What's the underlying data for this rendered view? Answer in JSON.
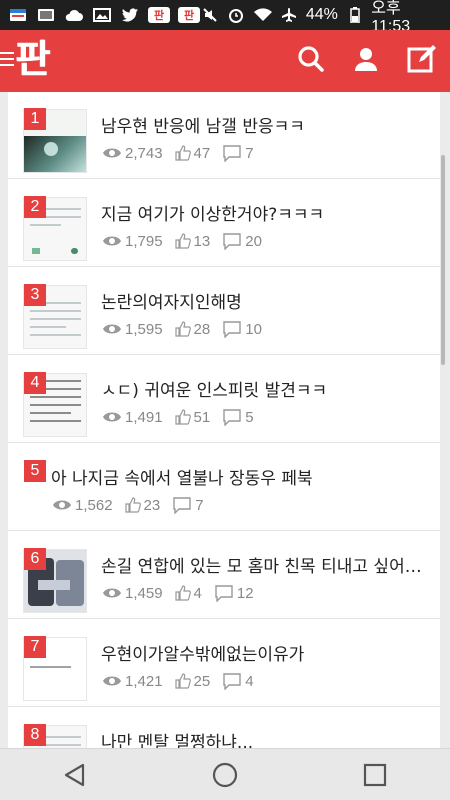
{
  "status_bar": {
    "battery": "44%",
    "time": "오후 11:53",
    "app_badge_1": "판",
    "app_badge_2": "판"
  },
  "header": {
    "logo": "판"
  },
  "items": [
    {
      "rank": "1",
      "title": "남우현 반응에 남갤 반응ㅋㅋ",
      "views": "2,743",
      "likes": "47",
      "comments": "7"
    },
    {
      "rank": "2",
      "title": "지금 여기가 이상한거야?ㅋㅋㅋ",
      "views": "1,795",
      "likes": "13",
      "comments": "20"
    },
    {
      "rank": "3",
      "title": "논란의여자지인해명",
      "views": "1,595",
      "likes": "28",
      "comments": "10"
    },
    {
      "rank": "4",
      "title": "ㅅㄷ) 귀여운 인스피릿 발견ㅋㅋ",
      "views": "1,491",
      "likes": "51",
      "comments": "5"
    },
    {
      "rank": "5",
      "title": "아 나지금 속에서 열불나 장동우 페북",
      "views": "1,562",
      "likes": "23",
      "comments": "7"
    },
    {
      "rank": "6",
      "title": "손길 연합에 있는 모 홈마 친목 티내고 싶어서...",
      "views": "1,459",
      "likes": "4",
      "comments": "12"
    },
    {
      "rank": "7",
      "title": "우현이가알수밖에없는이유가",
      "views": "1,421",
      "likes": "25",
      "comments": "4"
    },
    {
      "rank": "8",
      "title": "나만 멘탈 멀쩡하냐...",
      "views": "",
      "likes": "",
      "comments": ""
    }
  ],
  "colors": {
    "accent": "#e53f3f",
    "status_bar": "#1f1f1f",
    "nav_bar": "#e8e8e8"
  }
}
